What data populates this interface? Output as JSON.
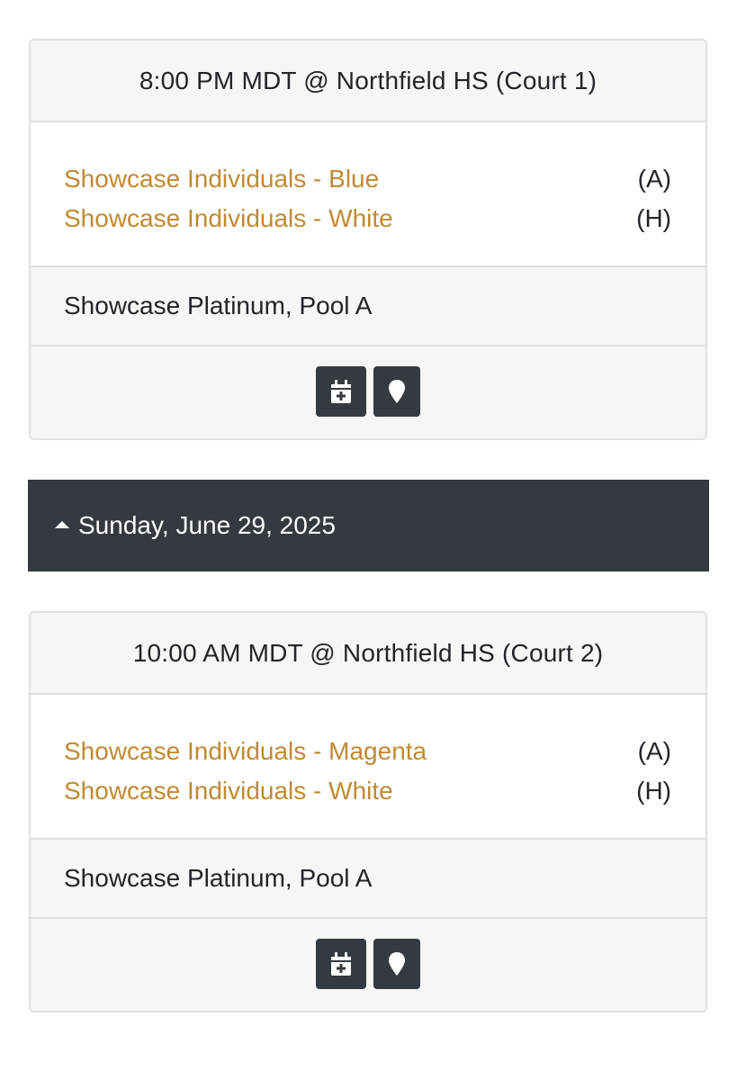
{
  "games": [
    {
      "header": "8:00 PM MDT @ Northfield HS (Court 1)",
      "teams": [
        {
          "name": "Showcase Individuals - Blue",
          "side": "(A)"
        },
        {
          "name": "Showcase Individuals - White",
          "side": "(H)"
        }
      ],
      "division": "Showcase Platinum, Pool A",
      "actions": {
        "calendar_icon": "calendar-plus-icon",
        "map_icon": "map-pin-icon"
      }
    },
    {
      "header": "10:00 AM MDT @ Northfield HS (Court 2)",
      "teams": [
        {
          "name": "Showcase Individuals - Magenta",
          "side": "(A)"
        },
        {
          "name": "Showcase Individuals - White",
          "side": "(H)"
        }
      ],
      "division": "Showcase Platinum, Pool A",
      "actions": {
        "calendar_icon": "calendar-plus-icon",
        "map_icon": "map-pin-icon"
      }
    }
  ],
  "day_header": {
    "label": "Sunday, June 29, 2025",
    "icon": "caret-up-icon"
  },
  "colors": {
    "team_link": "#c08a32",
    "dark_bar": "#353a40",
    "button_bg": "#343a40",
    "card_band": "#f6f6f6",
    "border": "#dfe0e1"
  }
}
